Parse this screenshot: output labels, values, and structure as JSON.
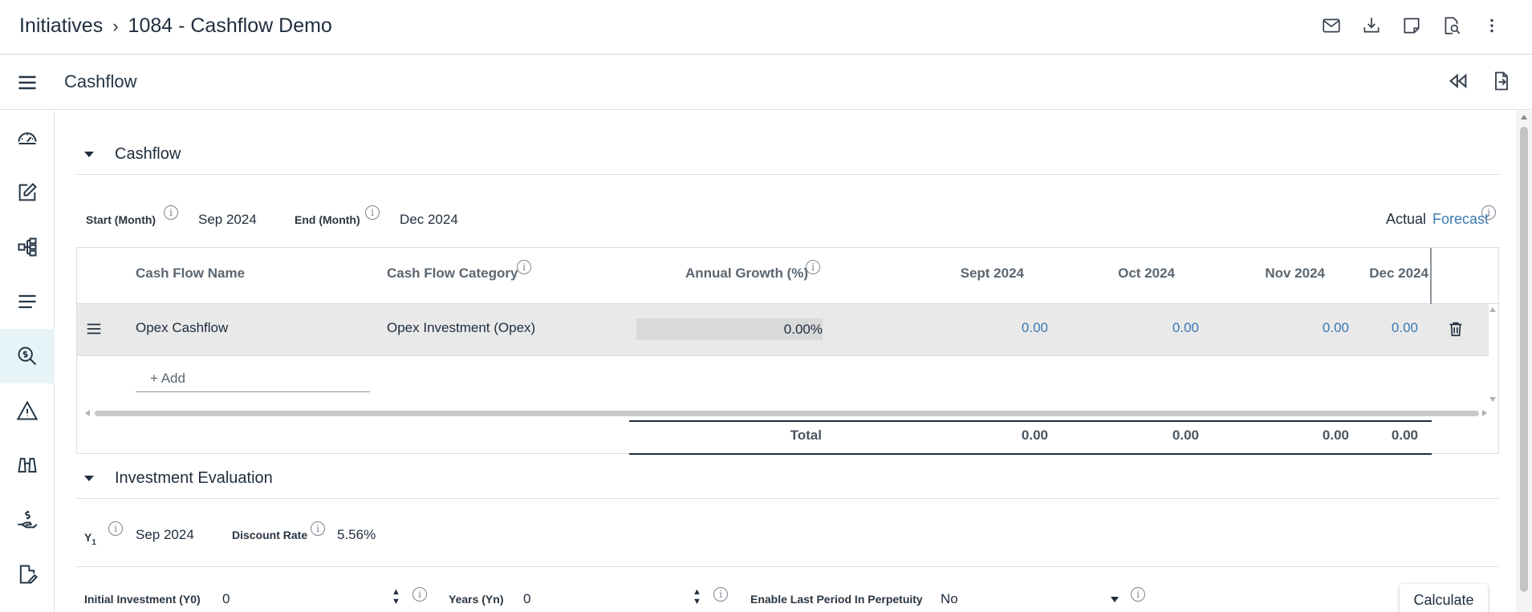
{
  "header": {
    "breadcrumb_root": "Initiatives",
    "breadcrumb_current": "1084 - Cashflow Demo",
    "icons": [
      "mail-icon",
      "download-icon",
      "note-icon",
      "preview-icon",
      "more-vertical-icon"
    ]
  },
  "subheader": {
    "title": "Cashflow",
    "icons": [
      "rewind-icon",
      "export-icon"
    ]
  },
  "rail": {
    "items": [
      "dashboard-icon",
      "edit-icon",
      "hierarchy-icon",
      "list-icon",
      "search-dollar-icon",
      "warning-icon",
      "binoculars-icon",
      "hand-money-icon",
      "document-edit-icon"
    ],
    "active_index": 4
  },
  "cashflow_section": {
    "title": "Cashflow",
    "start_label": "Start (Month)",
    "start_value": "Sep 2024",
    "end_label": "End (Month)",
    "end_value": "Dec 2024",
    "toggle_actual": "Actual",
    "toggle_forecast": "Forecast",
    "columns": {
      "name": "Cash Flow Name",
      "category": "Cash Flow Category",
      "growth": "Annual Growth (%)",
      "m1": "Sept 2024",
      "m2": "Oct 2024",
      "m3": "Nov 2024",
      "m4": "Dec 2024"
    },
    "rows": [
      {
        "name": "Opex Cashflow",
        "category": "Opex Investment (Opex)",
        "growth": "0.00%",
        "m1": "0.00",
        "m2": "0.00",
        "m3": "0.00",
        "m4": "0.00"
      }
    ],
    "add_label": "+ Add",
    "total": {
      "label": "Total",
      "m1": "0.00",
      "m2": "0.00",
      "m3": "0.00",
      "m4": "0.00"
    }
  },
  "evaluation_section": {
    "title": "Investment Evaluation",
    "y1_label": "Y",
    "y1_sub": "1",
    "y1_value": "Sep 2024",
    "discount_label": "Discount Rate",
    "discount_value": "5.56%",
    "initial_label": "Initial Investment (Y0)",
    "initial_value": "0",
    "years_label": "Years (Yn)",
    "years_value": "0",
    "perpetuity_label": "Enable Last Period In Perpetuity",
    "perpetuity_value": "No",
    "calculate_label": "Calculate"
  }
}
